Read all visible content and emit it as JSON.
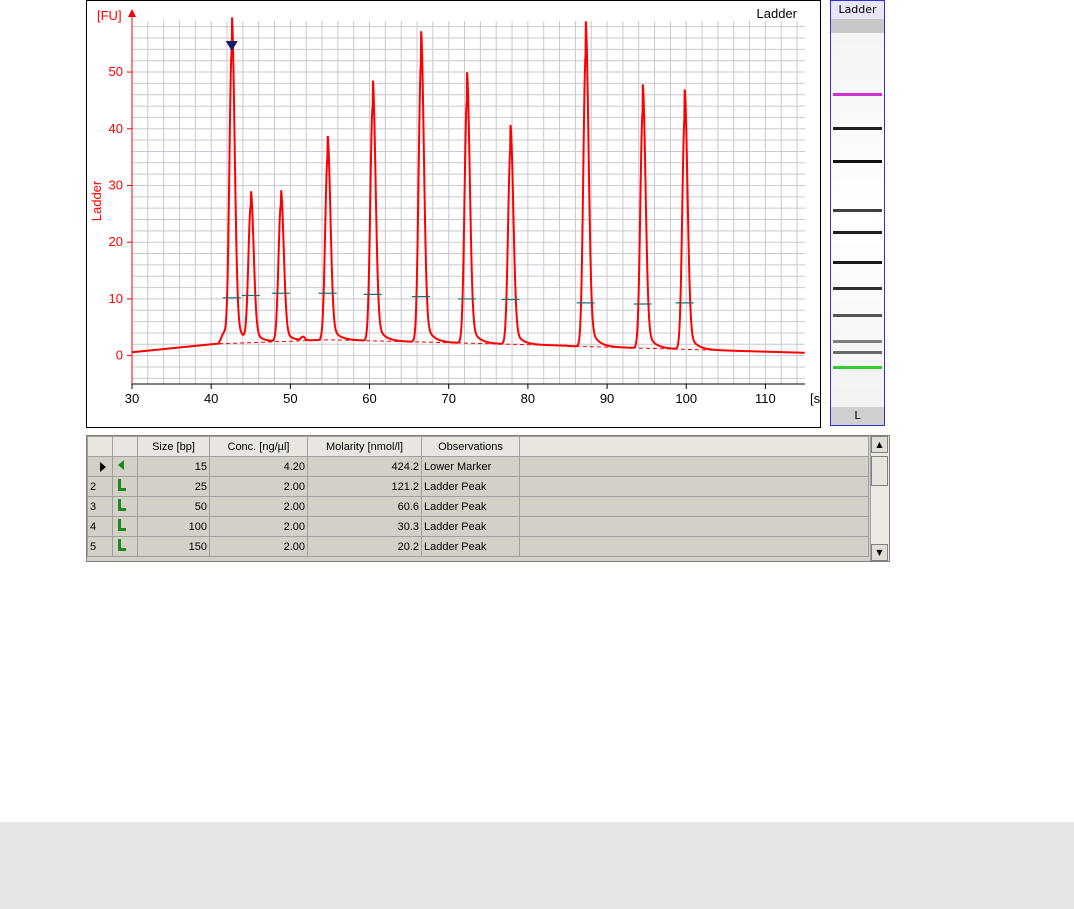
{
  "chart_data": {
    "type": "line",
    "title": "Ladder",
    "ylabel": "Ladder",
    "yunit": "[FU]",
    "xunit": "[s]",
    "xlim": [
      30,
      115
    ],
    "ylim": [
      -5,
      59
    ],
    "xticks": [
      30,
      40,
      50,
      60,
      70,
      80,
      90,
      100,
      110
    ],
    "yticks": [
      0,
      10,
      20,
      30,
      40,
      50
    ],
    "grid": true,
    "series": [
      {
        "name": "Ladder",
        "color": "#ff0000",
        "peaks": [
          {
            "x": 42.6,
            "y": 54
          },
          {
            "x": 45.0,
            "y": 26
          },
          {
            "x": 48.8,
            "y": 26.5
          },
          {
            "x": 54.7,
            "y": 35
          },
          {
            "x": 60.4,
            "y": 44
          },
          {
            "x": 66.5,
            "y": 51.5
          },
          {
            "x": 72.3,
            "y": 45
          },
          {
            "x": 77.8,
            "y": 36.5
          },
          {
            "x": 87.3,
            "y": 53
          },
          {
            "x": 94.5,
            "y": 43
          },
          {
            "x": 99.8,
            "y": 42
          }
        ]
      }
    ],
    "threshold_marks": [
      {
        "x": 42.6,
        "y": 10.2
      },
      {
        "x": 45.0,
        "y": 10.6
      },
      {
        "x": 48.8,
        "y": 11.0
      },
      {
        "x": 54.7,
        "y": 11.0
      },
      {
        "x": 60.4,
        "y": 10.8
      },
      {
        "x": 66.5,
        "y": 10.4
      },
      {
        "x": 72.3,
        "y": 10.0
      },
      {
        "x": 77.8,
        "y": 9.9
      },
      {
        "x": 87.3,
        "y": 9.3
      },
      {
        "x": 94.5,
        "y": 9.1
      },
      {
        "x": 99.8,
        "y": 9.3
      }
    ],
    "marker_triangle_x": 42.6,
    "marker_triangle_color": "#1a1a66"
  },
  "gel": {
    "title": "Ladder",
    "lane_label": "L",
    "bands": [
      {
        "pos": 0.16,
        "color": "#d030d0"
      },
      {
        "pos": 0.25,
        "color": "#202020"
      },
      {
        "pos": 0.34,
        "color": "#101010"
      },
      {
        "pos": 0.47,
        "color": "#404040"
      },
      {
        "pos": 0.53,
        "color": "#202020"
      },
      {
        "pos": 0.61,
        "color": "#181818"
      },
      {
        "pos": 0.68,
        "color": "#303030"
      },
      {
        "pos": 0.75,
        "color": "#555555"
      },
      {
        "pos": 0.82,
        "color": "#808080"
      },
      {
        "pos": 0.85,
        "color": "#6a6a6a"
      },
      {
        "pos": 0.89,
        "color": "#33cc33"
      }
    ]
  },
  "table": {
    "headers": [
      "",
      "",
      "Size [bp]",
      "Conc. [ng/µl]",
      "Molarity [nmol/l]",
      "Observations",
      ""
    ],
    "rows": [
      {
        "index": "",
        "current": true,
        "icon": "lower-marker",
        "size": "15",
        "conc": "4.20",
        "molarity": "424.2",
        "obs": "Lower Marker"
      },
      {
        "index": "2",
        "current": false,
        "icon": "ladder-peak",
        "size": "25",
        "conc": "2.00",
        "molarity": "121.2",
        "obs": "Ladder Peak"
      },
      {
        "index": "3",
        "current": false,
        "icon": "ladder-peak",
        "size": "50",
        "conc": "2.00",
        "molarity": "60.6",
        "obs": "Ladder Peak"
      },
      {
        "index": "4",
        "current": false,
        "icon": "ladder-peak",
        "size": "100",
        "conc": "2.00",
        "molarity": "30.3",
        "obs": "Ladder Peak"
      },
      {
        "index": "5",
        "current": false,
        "icon": "ladder-peak",
        "size": "150",
        "conc": "2.00",
        "molarity": "20.2",
        "obs": "Ladder Peak"
      }
    ]
  }
}
